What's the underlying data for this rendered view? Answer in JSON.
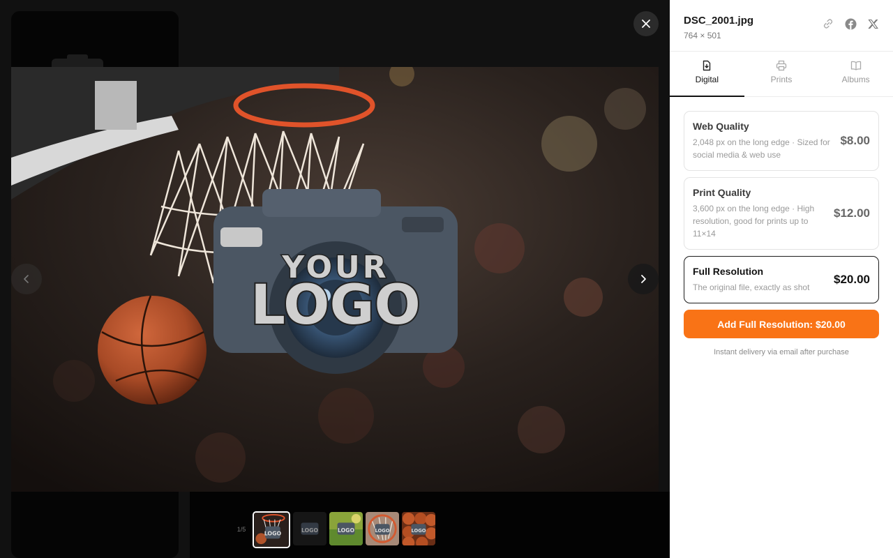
{
  "viewer": {
    "counter": "1/5",
    "photo_watermark": "YOUR LOGO",
    "thumbnails": [
      {
        "name": "basketball-hoop",
        "active": true
      },
      {
        "name": "dark-logo",
        "active": false
      },
      {
        "name": "green-field",
        "active": false
      },
      {
        "name": "hoop-net",
        "active": false
      },
      {
        "name": "basketballs",
        "active": false
      }
    ],
    "icons": {
      "close": "close-icon",
      "prev": "chevron-left-icon",
      "next": "chevron-right-icon"
    }
  },
  "panel": {
    "file_name": "DSC_2001.jpg",
    "dimensions": "764 × 501",
    "share_icons": [
      "link-icon",
      "facebook-icon",
      "x-icon"
    ],
    "tabs": [
      {
        "label": "Digital",
        "icon": "download-file-icon",
        "active": true
      },
      {
        "label": "Prints",
        "icon": "printer-icon",
        "active": false
      },
      {
        "label": "Albums",
        "icon": "book-icon",
        "active": false
      }
    ],
    "options": [
      {
        "title": "Web Quality",
        "desc": "2,048 px on the long edge · Sized for social media & web use",
        "price": "$8.00",
        "selected": false
      },
      {
        "title": "Print Quality",
        "desc": "3,600 px on the long edge · High resolution, good for prints up to 11×14",
        "price": "$12.00",
        "selected": false
      },
      {
        "title": "Full Resolution",
        "desc": "The original file, exactly as shot",
        "price": "$20.00",
        "selected": true
      }
    ],
    "add_button": "Add Full Resolution: $20.00",
    "delivery_note": "Instant delivery via email after purchase"
  },
  "colors": {
    "accent": "#f97316",
    "viewer_bg": "#111111",
    "panel_bg": "#ffffff"
  }
}
